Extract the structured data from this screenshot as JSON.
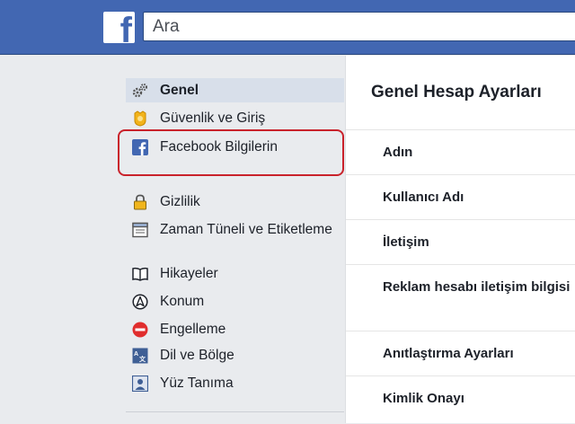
{
  "header": {
    "logo_letter": "f",
    "search_placeholder": "Ara"
  },
  "sidebar": {
    "items": [
      {
        "label": "Genel",
        "icon": "gears-icon"
      },
      {
        "label": "Güvenlik ve Giriş",
        "icon": "badge-icon"
      },
      {
        "label": "Facebook Bilgilerin",
        "icon": "facebook-icon"
      },
      {
        "label": "Gizlilik",
        "icon": "lock-icon"
      },
      {
        "label": "Zaman Tüneli ve Etiketleme",
        "icon": "timeline-icon"
      },
      {
        "label": "Hikayeler",
        "icon": "book-icon"
      },
      {
        "label": "Konum",
        "icon": "location-icon"
      },
      {
        "label": "Engelleme",
        "icon": "block-icon"
      },
      {
        "label": "Dil ve Bölge",
        "icon": "language-icon"
      },
      {
        "label": "Yüz Tanıma",
        "icon": "face-icon"
      }
    ]
  },
  "main": {
    "title": "Genel Hesap Ayarları",
    "rows": [
      {
        "label": "Adın"
      },
      {
        "label": "Kullanıcı Adı"
      },
      {
        "label": "İletişim"
      },
      {
        "label": "Reklam hesabı iletişim bilgisi"
      },
      {
        "label": "Anıtlaştırma Ayarları"
      },
      {
        "label": "Kimlik Onayı"
      }
    ]
  },
  "colors": {
    "brand_blue": "#4267b2",
    "highlight_red": "#c9222b",
    "selected_bg": "#d8dfea"
  }
}
